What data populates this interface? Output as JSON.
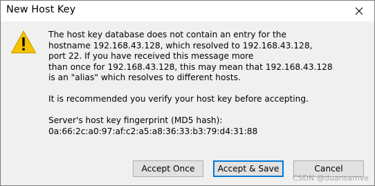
{
  "window": {
    "title": "New Host Key",
    "close_icon": "close-icon"
  },
  "message": {
    "icon": "warning-icon",
    "lines": [
      "The host key database does not contain an entry for the",
      "hostname 192.168.43.128, which resolved to 192.168.43.128,",
      "port 22.  If you have received this message more",
      "than once for 192.168.43.128, this may mean that 192.168.43.128",
      "is an \"alias\" which resolves to different hosts."
    ],
    "recommendation": "It is recommended you verify your host key before accepting.",
    "fingerprint_label": "Server's host key fingerprint (MD5 hash):",
    "fingerprint_value": "0a:66:2c:a0:97:af:c2:a5:a8:36:33:b3:79:d4:31:88"
  },
  "buttons": {
    "accept_once": "Accept Once",
    "accept_save": "Accept & Save",
    "cancel": "Cancel"
  },
  "watermark": "CSDN @duansamve",
  "colors": {
    "warning_yellow": "#f5c400",
    "default_button_border": "#0078d7",
    "button_face": "#e1e1e1",
    "dialog_bg": "#f0f0f0"
  }
}
